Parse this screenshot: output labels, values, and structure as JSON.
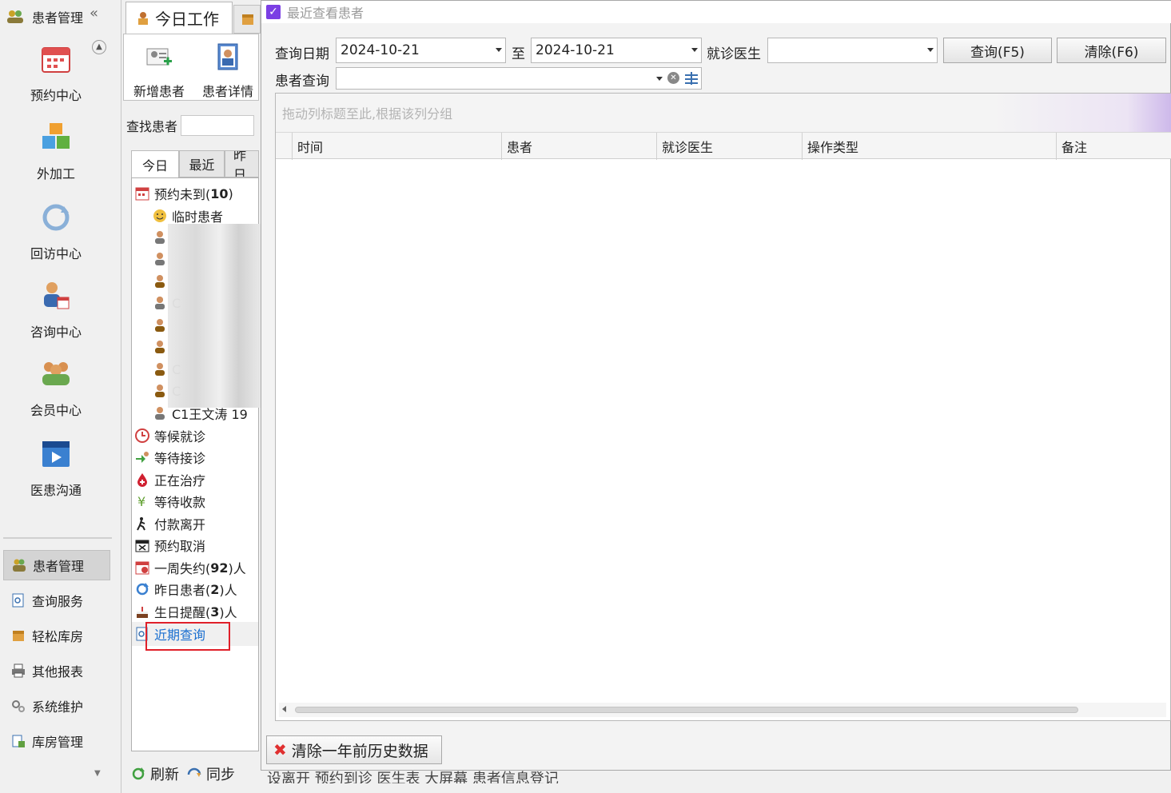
{
  "leftnav": {
    "header": "患者管理",
    "collapse": "«",
    "big_items": [
      {
        "label": "预约中心",
        "icon": "calendar-icon"
      },
      {
        "label": "外加工",
        "icon": "cubes-icon"
      },
      {
        "label": "回访中心",
        "icon": "refresh-icon"
      },
      {
        "label": "咨询中心",
        "icon": "consult-icon"
      },
      {
        "label": "会员中心",
        "icon": "members-icon"
      },
      {
        "label": "医患沟通",
        "icon": "video-icon"
      }
    ],
    "small_items": [
      {
        "label": "患者管理",
        "active": true,
        "icon": "patients-icon"
      },
      {
        "label": "查询服务",
        "active": false,
        "icon": "search-doc-icon"
      },
      {
        "label": "轻松库房",
        "active": false,
        "icon": "box-icon"
      },
      {
        "label": "其他报表",
        "active": false,
        "icon": "printer-icon"
      },
      {
        "label": "系统维护",
        "active": false,
        "icon": "gears-icon"
      },
      {
        "label": "库房管理",
        "active": false,
        "icon": "warehouse-icon"
      }
    ]
  },
  "workpanel": {
    "tab_label": "今日工作",
    "ribbon": [
      {
        "label": "新增患者",
        "icon": "add-patient-icon"
      },
      {
        "label": "患者详情",
        "icon": "patient-detail-icon"
      }
    ],
    "find_label": "查找患者",
    "subtabs": [
      "今日",
      "最近",
      "昨日"
    ],
    "tree": {
      "appointment_label": "预约未到(",
      "appointment_count": "10",
      "appointment_suffix": ")",
      "temp_patient": "临时患者",
      "patient_rows": [
        "",
        "",
        "",
        "",
        "C",
        "",
        "",
        "C",
        "C",
        "C1王文涛 19"
      ],
      "statuses": [
        {
          "label": "等候就诊",
          "icon": "waiting-icon"
        },
        {
          "label": "等待接诊",
          "icon": "receive-icon"
        },
        {
          "label": "正在治疗",
          "icon": "treatment-icon"
        },
        {
          "label": "等待收款",
          "icon": "payment-icon"
        },
        {
          "label": "付款离开",
          "icon": "leave-icon"
        },
        {
          "label": "预约取消",
          "icon": "cancel-icon"
        }
      ],
      "week_missed_prefix": "一周失约(",
      "week_missed_count": "92",
      "week_missed_suffix": ")人",
      "yesterday_prefix": "昨日患者(",
      "yesterday_count": "2",
      "yesterday_suffix": ")人",
      "birthday_prefix": "生日提醒(",
      "birthday_count": "3",
      "birthday_suffix": ")人",
      "recent_query": "近期查询"
    },
    "bottom": {
      "refresh": "刷新",
      "sync": "同步"
    },
    "behind_strip": "设离开   预约到诊   医生表   大屏幕   患者信息登记"
  },
  "dialog": {
    "title": "最近查看患者",
    "query_date_label": "查询日期",
    "date_from": "2024-10-21",
    "to_label": "至",
    "date_to": "2024-10-21",
    "doctor_label": "就诊医生",
    "doctor_value": "",
    "query_button": "查询(F5)",
    "clear_button": "清除(F6)",
    "patient_query_label": "患者查询",
    "patient_query_value": "",
    "group_hint": "拖动列标题至此,根据该列分组",
    "columns": [
      "时间",
      "患者",
      "就诊医生",
      "操作类型",
      "备注"
    ],
    "clear_history_button": "清除一年前历史数据"
  },
  "colors": {
    "accent": "#7b3fe4",
    "highlight_box": "#e0202a",
    "link": "#1a6fd0"
  }
}
